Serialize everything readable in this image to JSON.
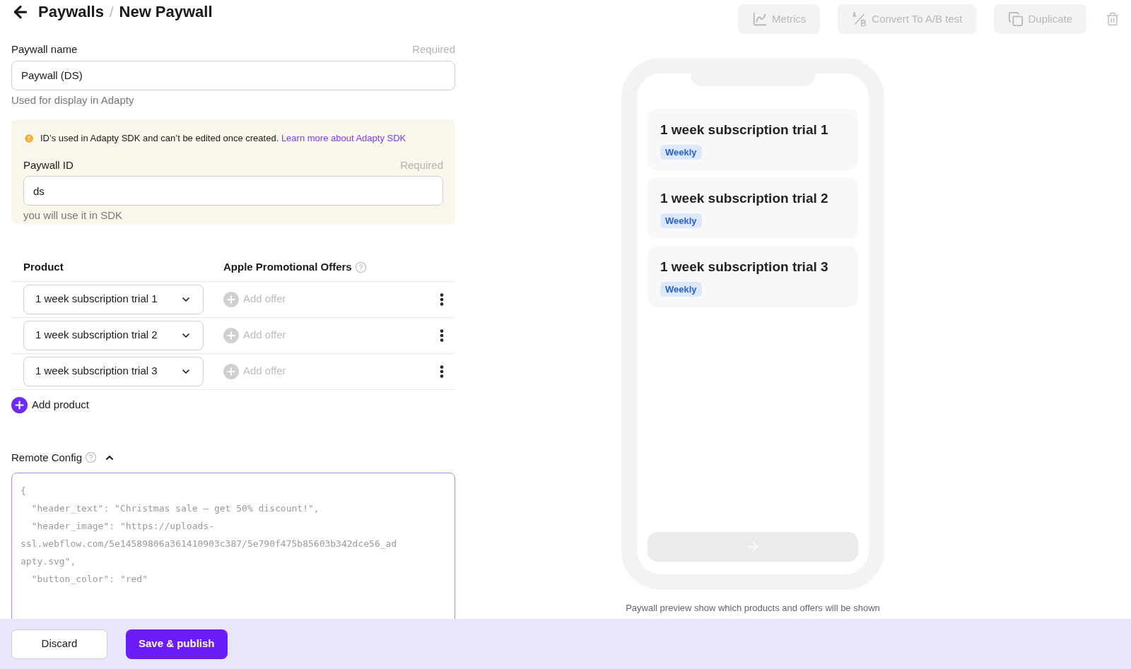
{
  "breadcrumb": {
    "parent": "Paywalls",
    "separator": "/",
    "current": "New Paywall"
  },
  "toolbar": [
    {
      "kind": "metrics",
      "label": "Metrics",
      "disabled": true
    },
    {
      "kind": "ab",
      "label": "Convert To A/B test",
      "disabled": true
    },
    {
      "kind": "duplicate",
      "label": "Duplicate",
      "disabled": true
    }
  ],
  "paywall_name": {
    "label": "Paywall name",
    "required": "Required",
    "value": "Paywall (DS)",
    "hint": "Used for display in Adapty"
  },
  "notice": {
    "text": "ID’s used in Adapty SDK and can’t be edited once created.",
    "link": "Learn more about Adapty SDK"
  },
  "paywall_id": {
    "label": "Paywall ID",
    "required": "Required",
    "value": "ds",
    "hint": "you will use it in SDK"
  },
  "products_table": {
    "columns": [
      "Product",
      "Apple Promotional Offers"
    ],
    "rows": [
      {
        "product": "1 week subscription trial 1",
        "offer": "Add offer"
      },
      {
        "product": "1 week subscription trial 2",
        "offer": "Add offer"
      },
      {
        "product": "1 week subscription trial 3",
        "offer": "Add offer"
      }
    ],
    "add_product": "Add product"
  },
  "remote_config": {
    "label": "Remote Config",
    "expanded": true,
    "lines": [
      "{",
      "  \"header_text\": \"Christmas sale — get 50% discount!\",",
      "  \"header_image\": \"https://uploads-",
      "ssl.webflow.com/5e14589806a361410903c387/5e790f475b85603b342dce56_ad",
      "apty.svg\",",
      "  \"button_color\": \"red\""
    ]
  },
  "preview": {
    "cards": [
      {
        "title": "1 week subscription trial 1",
        "tag": "Weekly"
      },
      {
        "title": "1 week subscription trial 2",
        "tag": "Weekly"
      },
      {
        "title": "1 week subscription trial 3",
        "tag": "Weekly"
      }
    ],
    "caption": "Paywall preview show which products and offers will be shown"
  },
  "footer": {
    "buttons": [
      {
        "kind": "secondary",
        "label": "Discard"
      },
      {
        "kind": "primary",
        "label": "Save & publish"
      }
    ]
  }
}
